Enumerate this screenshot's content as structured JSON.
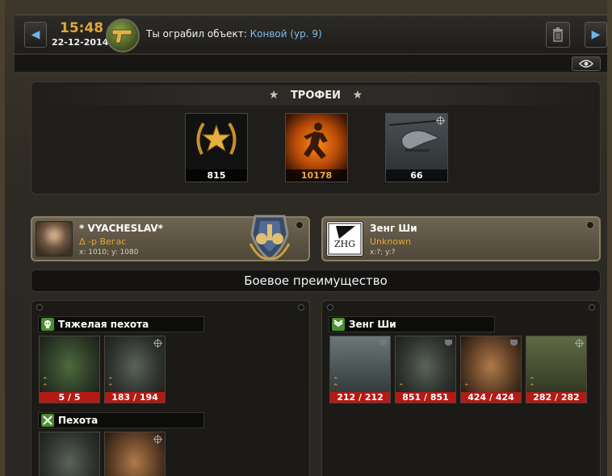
{
  "header": {
    "time": "15:48",
    "date": "22-12-2014",
    "event_text": "Ты ограбил объект:",
    "event_link": "Конвой (ур. 9)",
    "prev_icon": "chevron-left-icon",
    "next_icon": "chevron-right-icon",
    "delete_icon": "trash-icon",
    "visibility_icon": "eye-icon"
  },
  "trophies": {
    "title": "ТРОФЕИ",
    "items": [
      {
        "icon": "laurel-star-icon",
        "count": "815"
      },
      {
        "icon": "running-soldier-icon",
        "count": "10178"
      },
      {
        "icon": "helicopter-icon",
        "count": "66"
      }
    ]
  },
  "players": {
    "attacker": {
      "name": "* VYACHESLAV*",
      "location": "Δ -р Вегас",
      "coords": "x: 1010; y: 1080"
    },
    "defender": {
      "name": "Зенг Ши",
      "location": "Unknown",
      "coords": "x:?; y:?",
      "avatar_text": "ZHG"
    }
  },
  "advantage": "Боевое преимущество",
  "armies": {
    "left": {
      "groups": [
        {
          "title": "Тяжелая пехота",
          "icon": "skull-icon",
          "units": [
            {
              "hp": "5 / 5",
              "type": "heavy"
            },
            {
              "hp": "183 / 194",
              "type": "soldier"
            }
          ]
        },
        {
          "title": "Пехота",
          "icon": "crossed-rifles-icon",
          "units": [
            {
              "hp": "",
              "type": "soldier"
            },
            {
              "hp": "",
              "type": "desert"
            }
          ]
        }
      ]
    },
    "right": {
      "groups": [
        {
          "title": "Зенг Ши",
          "icon": "rank-chevron-icon",
          "units": [
            {
              "hp": "212 / 212",
              "type": "heli"
            },
            {
              "hp": "851 / 851",
              "type": "soldier"
            },
            {
              "hp": "424 / 424",
              "type": "desert"
            },
            {
              "hp": "282 / 282",
              "type": "jeep"
            }
          ]
        }
      ]
    }
  },
  "colors": {
    "accent_gold": "#e0a838",
    "link_blue": "#7fbde8",
    "hp_red": "#b41a14",
    "group_green": "#4b8e2f"
  }
}
